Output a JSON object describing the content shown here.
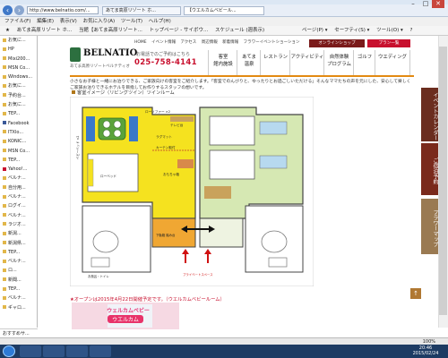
{
  "browser": {
    "url": "http://www.belnatio.com/...",
    "tabs": [
      {
        "label": "あてま高原リゾート ホ..."
      },
      {
        "label": "【ウエルカムベビール..."
      }
    ],
    "window_controls": {
      "minimize": "–",
      "maximize": "□",
      "close": "✕"
    },
    "menu": [
      "ファイル(F)",
      "編集(E)",
      "表示(V)",
      "お気に入り(A)",
      "ツール(T)",
      "ヘルプ(H)"
    ],
    "favorites": [
      {
        "label": "あてま高原リゾート ホ..."
      },
      {
        "label": "当館【あてま高原リゾート..."
      },
      {
        "label": "トップページ - サイボウ..."
      },
      {
        "label": "スケジュール (週表示)"
      }
    ],
    "command_bar": [
      "ページ(P) ▾",
      "セーフティ(S) ▾",
      "ツール(O) ▾",
      "?"
    ],
    "status_zoom": "100%"
  },
  "sidebar": {
    "items": [
      "お気に...",
      "HP",
      "Mixi200...",
      "MSN Co...",
      "Windows...",
      "お気に...",
      "予約台...",
      "お気に...",
      "TEP...",
      "Facebook",
      "ITXlo...",
      "KONIC...",
      "MSN Co...",
      "TEP...",
      "Yahoo!...",
      "ベルナ...",
      "自分用...",
      "ベルナ...",
      "ログイ...",
      "ベルナ...",
      "ラジオ...",
      "新潟...",
      "新潟県...",
      "TEP...",
      "ベルナ...",
      "ロ...",
      "新聞...",
      "TEP...",
      "ベルナ...",
      "ギャロ..."
    ],
    "search": "おすすめサ..."
  },
  "header": {
    "logo": "BELNATIO",
    "logo_sub": "あてま高原リゾートベルナティオ",
    "phone_label": "お電話でのご予約はこちら",
    "phone": "025-758-4141",
    "topnav": [
      "HOME",
      "イベント情報",
      "アクセス",
      "周辺情報",
      "新着情報",
      "フラワーイベントショーション"
    ],
    "shop_label": "オンラインショップ",
    "plan_label": "プラン一覧",
    "mainnav": [
      {
        "label": "客室\n館内施設"
      },
      {
        "label": "あてま\n温泉"
      },
      {
        "label": "レストラン"
      },
      {
        "label": "アクティビティ"
      },
      {
        "label": "自然体験\nプログラム"
      },
      {
        "label": "ゴルフ"
      },
      {
        "label": "ウエディング"
      }
    ]
  },
  "content": {
    "intro": "小さなお子様と一緒にお泊りできる、ご家族向けの客室をご紹介します。「客室でのんびりと、ゆったりとお過ごしいただける」そんなママたちの声を元にした、安心して楽しくご家族お泊りできるホテルを目指してお作りするスタッフの想いです。",
    "section_title": "客室イメージ（リビングツイン）ツインルーム",
    "plan_labels": {
      "low_sofa": "ローソファー ×2",
      "tv": "テレビ台",
      "rug": "ラグマット",
      "curtain": "カーテン取付",
      "toy": "おもちゃ箱",
      "low_bed": "ローベッド",
      "step": "下駄箱 踏み台",
      "entrance": "ベビーカー置き場",
      "baby_bed": "ベビーベッド ×2",
      "bath": "お風呂・トイレ",
      "private_space": "プライベートスペース"
    },
    "banner_label": "★オープンは2015年4月22日開催予定です。（ウエルカムベビールーム）",
    "banner_text": "ウェルカムベビー",
    "banner_text2": "ウエルカム"
  },
  "side_tabs": [
    "イベントカレンダー",
    "ご宿泊予約",
    "フラワーマップ"
  ],
  "scroll_top_label": "↑",
  "taskbar": {
    "time": "20:46",
    "date": "2015/02/24"
  }
}
